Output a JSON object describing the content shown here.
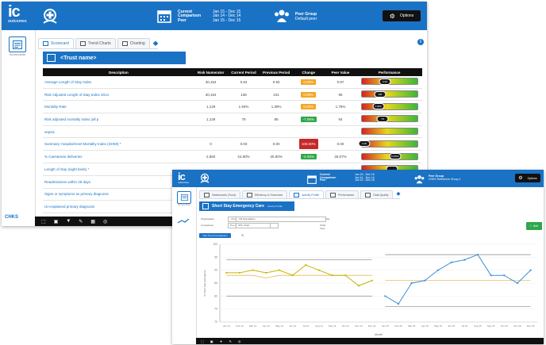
{
  "window1": {
    "logo": {
      "text": "ic",
      "sub": "outcomes"
    },
    "period": [
      {
        "label": "Current",
        "value": "Jan 15 - Dec 15"
      },
      {
        "label": "Comparison",
        "value": "Jan 14 - Dec 14"
      },
      {
        "label": "Peer",
        "value": "Jan 15 - Dec 15"
      }
    ],
    "peer_group": {
      "title": "Peer Group",
      "sub": "Default peer"
    },
    "options_label": "Options",
    "sidebar_label": "Scorecards",
    "tabs": [
      {
        "label": "Scorecard",
        "active": true
      },
      {
        "label": "Trend Charts",
        "active": false
      },
      {
        "label": "Charting",
        "active": false
      }
    ],
    "trust_name": "<Trust name>",
    "table": {
      "headers": [
        "Description",
        "Risk Numerator",
        "Current Period",
        "Previous Period",
        "Change",
        "Peer Value",
        "Performance"
      ],
      "rows": [
        {
          "desc": "Average Length of Stay Index",
          "num": "30,154",
          "cur": "0.94",
          "prev": "0.94",
          "change": "0.00%",
          "chg_color": "#f5a623",
          "peer": "0.97",
          "perf": 0.42,
          "perf_label": "0.94"
        },
        {
          "desc": "Risk Adjusted Length of Stay Index 2014",
          "num": "30,154",
          "cur": "138",
          "prev": "101",
          "change": "0.00%",
          "chg_color": "#f5a623",
          "peer": "96",
          "perf": 0.33,
          "perf_label": "138"
        },
        {
          "desc": "Mortality Rate",
          "num": "1,129",
          "cur": "1.94%",
          "prev": "1.39%",
          "change": "0.00%",
          "chg_color": "#f5a623",
          "peer": "1.78%",
          "perf": 0.3,
          "perf_label": "1.94%"
        },
        {
          "desc": "Risk adjusted mortality index (all p",
          "num": "1,129",
          "cur": "79",
          "prev": "85",
          "change": "-7.06%",
          "chg_color": "#2ea84a",
          "peer": "94",
          "perf": 0.38,
          "perf_label": "79"
        },
        {
          "desc": "sepsis",
          "num": "",
          "cur": "",
          "prev": "",
          "change": "",
          "chg_color": "",
          "peer": "",
          "perf": 0.0,
          "perf_label": ""
        },
        {
          "desc": "Summary Hospital-level Mortality Index (SHMI) *",
          "num": "0",
          "cur": "0.00",
          "prev": "0.00",
          "change": "100.00%",
          "chg_color": "#c62828",
          "peer": "0.00",
          "perf": 0.05,
          "perf_label": "0.00"
        },
        {
          "desc": "% Caesarean deliveries",
          "num": "2,650",
          "cur": "24.80%",
          "prev": "25.90%",
          "change": "-4.25%",
          "chg_color": "#2ea84a",
          "peer": "26.07%",
          "perf": 0.6,
          "perf_label": "24.80%"
        },
        {
          "desc": "Length of stay (night beds) *",
          "num": "",
          "cur": "",
          "prev": "",
          "change": "",
          "chg_color": "",
          "peer": "",
          "perf": 0.55,
          "perf_label": ""
        },
        {
          "desc": "Readmissions within 28 days",
          "num": "",
          "cur": "",
          "prev": "",
          "change": "",
          "chg_color": "",
          "peer": "",
          "perf": 0.5,
          "perf_label": ""
        },
        {
          "desc": "Signs or symptoms as primary diagnosis",
          "num": "",
          "cur": "",
          "prev": "",
          "change": "",
          "chg_color": "",
          "peer": "",
          "perf": 0.5,
          "perf_label": ""
        },
        {
          "desc": "Un-explained primary diagnosis",
          "num": "",
          "cur": "",
          "prev": "",
          "change": "",
          "chg_color": "",
          "peer": "",
          "perf": 0.5,
          "perf_label": ""
        }
      ]
    },
    "footer_brand": "CHKS"
  },
  "window2": {
    "logo": {
      "text": "ic",
      "sub": "outcomes"
    },
    "period": [
      {
        "label": "Current",
        "value": "Jan 15 - Dec 15"
      },
      {
        "label": "Comparison",
        "value": "Jan 14 - Dec 14"
      },
      {
        "label": "Peer",
        "value": "Jan 15 - Dec 15"
      }
    ],
    "peer_group": {
      "title": "Peer Group",
      "sub": "CHKS Reference Group 1"
    },
    "options_label": "Options",
    "sidebar_label": "Scorecards",
    "tabs": [
      {
        "label": "Dashboards (Trust)",
        "active": false
      },
      {
        "label": "Efficiency & Outcomes",
        "active": false
      },
      {
        "label": "Activity Profile",
        "active": true
      },
      {
        "label": "Performance",
        "active": false
      },
      {
        "label": "Data Quality",
        "active": false
      }
    ],
    "panel_title": "Short Stay Emergency Care",
    "panel_sub": "Activity Profile",
    "filters": [
      {
        "label": "Organisation",
        "value": "<Trust Name>"
      },
      {
        "label": "Specialty",
        "value": "<All Specialties>"
      },
      {
        "label": "Comparison",
        "value": "Pre-Comparison Period"
      },
      {
        "label": "Chart Type",
        "value": "SPC Chart"
      }
    ],
    "chip_label": "Year Trend Comparison",
    "add_label": "Add",
    "y_axis_label": "% Short Stay Emergency",
    "x_axis_label": "Month"
  },
  "chart_data": {
    "type": "line",
    "title": "",
    "ylabel": "% Short Stay Emergency",
    "xlabel": "Month",
    "ylim": [
      70,
      100
    ],
    "x": [
      "Jan 14",
      "Feb 14",
      "Mar 14",
      "Apr 14",
      "May 14",
      "Jun 14",
      "Jul 14",
      "Aug 14",
      "Sep 14",
      "Oct 14",
      "Nov 14",
      "Dec 14",
      "Jan 15",
      "Feb 15",
      "Mar 15",
      "Apr 15",
      "May 15",
      "Jun 15",
      "Jul 15",
      "Aug 15",
      "Sep 15",
      "Oct 15",
      "Nov 15",
      "Dec 15"
    ],
    "series": [
      {
        "values": [
          88,
          88,
          88,
          87,
          88,
          88,
          88,
          88,
          88,
          88,
          88,
          88,
          86,
          86,
          86,
          86,
          86,
          86,
          86,
          86,
          86,
          86,
          86,
          86
        ],
        "color": "#e8b85a",
        "role": "mean"
      },
      {
        "values": [
          94,
          94,
          94,
          94,
          94,
          94,
          94,
          94,
          94,
          94,
          94,
          94,
          96,
          96,
          96,
          96,
          96,
          96,
          96,
          96,
          96,
          96,
          96,
          96
        ],
        "color": "#999999",
        "role": "upper"
      },
      {
        "values": [
          80,
          80,
          80,
          80,
          80,
          80,
          80,
          80,
          80,
          80,
          80,
          80,
          76,
          76,
          76,
          76,
          76,
          76,
          76,
          76,
          76,
          76,
          76,
          76
        ],
        "color": "#999999",
        "role": "lower"
      },
      {
        "values": [
          89,
          89,
          90,
          89,
          90,
          88,
          92,
          90,
          88,
          88,
          84,
          86,
          null,
          null,
          null,
          null,
          null,
          null,
          null,
          null,
          null,
          null,
          null,
          null
        ],
        "color": "#c8b400"
      },
      {
        "values": [
          null,
          null,
          null,
          null,
          null,
          null,
          null,
          null,
          null,
          null,
          null,
          null,
          80,
          77,
          85,
          86,
          90,
          93,
          94,
          96,
          88,
          88,
          85,
          90
        ],
        "color": "#3a8fd8"
      }
    ]
  }
}
